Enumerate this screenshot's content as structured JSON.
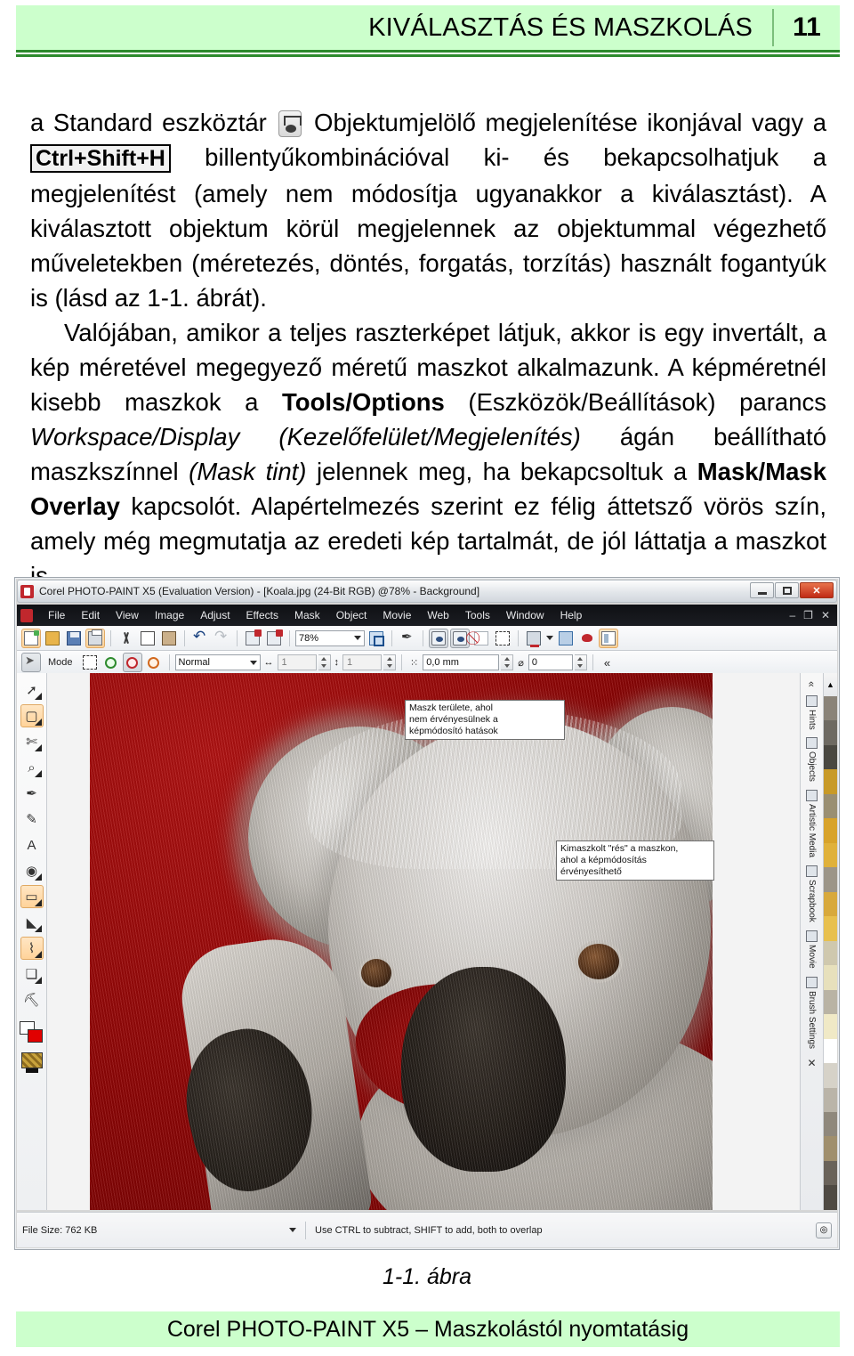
{
  "header": {
    "title": "KIVÁLASZTÁS ÉS MASZKOLÁS",
    "page_number": "11",
    "bg_color": "#ccffcc",
    "rule_color": "#2d8a2d"
  },
  "body": {
    "p1_a": "a Standard eszköztár ",
    "p1_icon": "object-marker-icon",
    "p1_b": " Objektumjelölő megjelenítése ikonjával vagy a ",
    "p1_kbd": "Ctrl+Shift+H",
    "p1_c": " billentyűkombinációval ki- és bekapcsolhatjuk a megjelenítést (amely nem módosítja ugyanakkor a kiválasztást). A kiválasztott objektum körül megjelennek az objektummal végezhető műveletekben (méretezés, döntés, forgatás, torzítás) használt fogantyúk is (lásd az 1-1. ábrát).",
    "p2_a": "Valójában, amikor a teljes raszterképet látjuk, akkor is egy invertált, a kép méretével megegyező méretű maszkot alkalmazunk. A képméretnél kisebb maszkok a ",
    "p2_b_bold": "Tools/Options",
    "p2_c": " (Eszközök/Beállítások) parancs ",
    "p2_d_italic": "Workspace/Display",
    "p2_e_italic": " (Kezelőfelület/Megjelenítés)",
    "p2_f": " ágán beállítható maszkszínnel ",
    "p2_g_italic": "(Mask tint)",
    "p2_h": " jelennek meg, ha bekapcsoltuk a ",
    "p2_i_bold": "Mask/Mask Overlay",
    "p2_j": " kapcsolót. Alapértelmezés szerint ez félig áttetsző vörös szín, amely még megmutatja az eredeti kép tartalmát, de jól láttatja a maszkot is."
  },
  "screenshot": {
    "titlebar": {
      "text": "Corel PHOTO-PAINT X5 (Evaluation Version) - [Koala.jpg (24-Bit RGB) @78% - Background]",
      "minimize": "minimize-icon",
      "restore": "restore-icon",
      "close": "✕"
    },
    "menubar": {
      "items": [
        "File",
        "Edit",
        "View",
        "Image",
        "Adjust",
        "Effects",
        "Mask",
        "Object",
        "Movie",
        "Web",
        "Tools",
        "Window",
        "Help"
      ],
      "doc_buttons": [
        "–",
        "❐",
        "✕"
      ]
    },
    "toolbar": {
      "zoom_level": "78%",
      "buttons": [
        {
          "name": "new-icon",
          "state": "on"
        },
        {
          "name": "open-icon",
          "state": "off"
        },
        {
          "name": "save-icon",
          "state": "off"
        },
        {
          "name": "print-icon",
          "state": "on"
        },
        {
          "name": "cut-icon",
          "state": "off"
        },
        {
          "name": "copy-icon",
          "state": "off"
        },
        {
          "name": "paste-icon",
          "state": "off"
        },
        {
          "name": "undo-icon",
          "state": "off"
        },
        {
          "name": "redo-icon",
          "state": "off"
        },
        {
          "name": "import-icon",
          "state": "off"
        },
        {
          "name": "export-icon",
          "state": "off"
        }
      ],
      "right_buttons": [
        {
          "name": "full-screen-preview-icon",
          "state": "off"
        },
        {
          "name": "brush-icon",
          "state": "off"
        },
        {
          "name": "mask-overlay-icon",
          "state": "pressed"
        },
        {
          "name": "mask-marquee-icon",
          "state": "pressed"
        },
        {
          "name": "remove-mask-icon",
          "state": "off"
        },
        {
          "name": "mask-dashed-icon",
          "state": "off"
        },
        {
          "name": "display-icon",
          "state": "off"
        },
        {
          "name": "image-adjust-icon",
          "state": "off"
        },
        {
          "name": "object-icon",
          "state": "off"
        },
        {
          "name": "docker-icon",
          "state": "on"
        }
      ]
    },
    "propbar": {
      "mode_label": "Mode",
      "normal_value": "Normal",
      "width_value": "1",
      "height_value": "1",
      "feather_value": "0,0 mm",
      "angle_value": "0",
      "collapse_icon": "collapse-chevron-icon"
    },
    "toolbox": [
      {
        "name": "pick-tool",
        "glyph": "➚",
        "state": "off"
      },
      {
        "name": "rectangle-mask-tool",
        "glyph": "▢",
        "state": "on"
      },
      {
        "name": "crop-tool",
        "glyph": "✂",
        "state": "off"
      },
      {
        "name": "zoom-tool",
        "glyph": "🔍",
        "state": "off"
      },
      {
        "name": "eyedropper-tool",
        "glyph": "✒",
        "state": "off"
      },
      {
        "name": "eraser-tool",
        "glyph": "✎",
        "state": "off"
      },
      {
        "name": "text-tool",
        "glyph": "A",
        "state": "off"
      },
      {
        "name": "red-eye-tool",
        "glyph": "◉",
        "state": "off"
      },
      {
        "name": "rectangle-shape-tool",
        "glyph": "▭",
        "state": "on"
      },
      {
        "name": "fill-tool",
        "glyph": "◢",
        "state": "off"
      },
      {
        "name": "interactive-fill-tool",
        "glyph": "⌇",
        "state": "on"
      },
      {
        "name": "object-transparency-tool",
        "glyph": "❏",
        "state": "off"
      },
      {
        "name": "clone-tool",
        "glyph": "⛭",
        "state": "off"
      }
    ],
    "canvas": {
      "mask_tint_color": "#8d0505",
      "callout_1": "Maszk területe, ahol\nnem érvényesülnek a\nképmódosító hatások",
      "callout_2": "Kimaszkolt \"rés\" a maszkon,\nahol a képmódosítás\nérvényesíthető"
    },
    "dockers": {
      "collapse": "«",
      "tabs": [
        "Hints",
        "Objects",
        "Artistic Media",
        "Scrapbook",
        "Movie",
        "Brush Settings"
      ],
      "close": "✕"
    },
    "palette": {
      "colors": [
        "#8a8378",
        "#6e6a62",
        "#4a4841",
        "#c89a28",
        "#9a8f72",
        "#d8a32a",
        "#e0b13a",
        "#9c9588",
        "#d8a93c",
        "#e8c04e",
        "#cfc8ae",
        "#e7e0bc",
        "#b9b3a4",
        "#f0e9c6",
        "#ffffff",
        "#d6d2c8",
        "#bab4a8",
        "#8f887c",
        "#a08f6d",
        "#6a635a",
        "#4f4a43"
      ]
    },
    "statusbar": {
      "file_size": "File Size: 762 KB",
      "hint": "Use CTRL to subtract, SHIFT to add, both to overlap",
      "right_icon": "color-proof-icon"
    }
  },
  "figure_caption": "1-1. ábra",
  "footer": {
    "text": "Corel PHOTO-PAINT X5 – Maszkolástól nyomtatásig",
    "bg_color": "#ccffcc"
  }
}
